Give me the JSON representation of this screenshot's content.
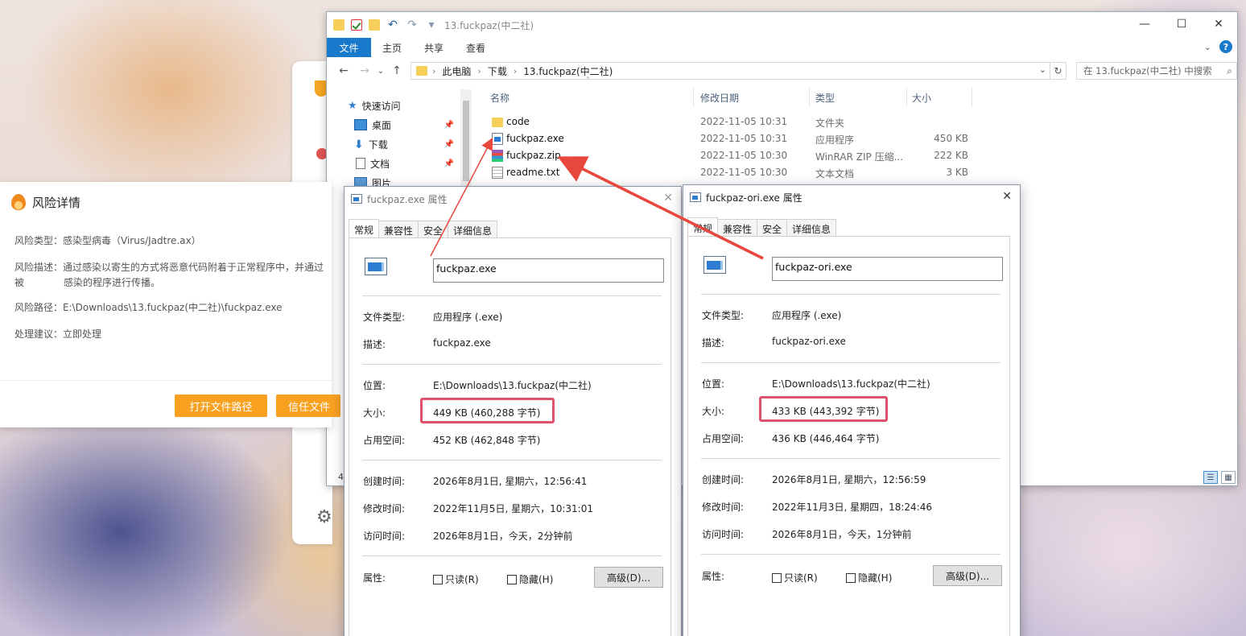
{
  "explorer": {
    "title": "13.fuckpaz(中二社)",
    "ribbon_tabs": [
      "文件",
      "主页",
      "共享",
      "查看"
    ],
    "breadcrumb": [
      "此电脑",
      "下载",
      "13.fuckpaz(中二社)"
    ],
    "search_placeholder": "在 13.fuckpaz(中二社) 中搜索",
    "nav_items": [
      {
        "label": "快速访问",
        "icon": "star-icon"
      },
      {
        "label": "桌面",
        "icon": "desktop-icon"
      },
      {
        "label": "下载",
        "icon": "download-icon"
      },
      {
        "label": "文档",
        "icon": "document-icon"
      },
      {
        "label": "图片",
        "icon": "picture-icon"
      }
    ],
    "columns": [
      "名称",
      "修改日期",
      "类型",
      "大小"
    ],
    "files": [
      {
        "name": "code",
        "date": "2022-11-05 10:31",
        "type": "文件夹",
        "size": "",
        "icon": "folder-icon"
      },
      {
        "name": "fuckpaz.exe",
        "date": "2022-11-05 10:31",
        "type": "应用程序",
        "size": "450 KB",
        "icon": "exe-icon"
      },
      {
        "name": "fuckpaz.zip",
        "date": "2022-11-05 10:30",
        "type": "WinRAR ZIP 压缩...",
        "size": "222 KB",
        "icon": "zip-icon"
      },
      {
        "name": "readme.txt",
        "date": "2022-11-05 10:30",
        "type": "文本文档",
        "size": "3 KB",
        "icon": "txt-icon"
      }
    ],
    "status_count": "4"
  },
  "risk": {
    "title": "风险详情",
    "type_label": "风险类型：",
    "type_value": "感染型病毒（Virus/Jadtre.ax）",
    "desc_label": "风险描述：",
    "desc_value_1": "通过感染以寄生的方式将恶意代码附着于正常程序中，并通过被",
    "desc_value_2": "感染的程序进行传播。",
    "path_label": "风险路径：",
    "path_value": "E:\\Downloads\\13.fuckpaz(中二社)\\fuckpaz.exe",
    "advice_label": "处理建议：",
    "advice_value": "立即处理",
    "open_button": "打开文件路径",
    "trust_button": "信任文件"
  },
  "dialog1": {
    "title": "fuckpaz.exe 属性",
    "tabs": [
      "常规",
      "兼容性",
      "安全",
      "详细信息"
    ],
    "filename": "fuckpaz.exe",
    "labels": {
      "type": "文件类型:",
      "desc": "描述:",
      "location": "位置:",
      "size": "大小:",
      "disk": "占用空间:",
      "created": "创建时间:",
      "modified": "修改时间:",
      "accessed": "访问时间:",
      "attrs": "属性:"
    },
    "type_value": "应用程序 (.exe)",
    "desc_value": "fuckpaz.exe",
    "location_value": "E:\\Downloads\\13.fuckpaz(中二社)",
    "size_value": "449 KB (460,288 字节)",
    "disk_value": "452 KB (462,848 字节)",
    "created_value": "2026年8月1日, 星期六，12:56:41",
    "modified_value": "2022年11月5日, 星期六，10:31:01",
    "accessed_value": "2026年8月1日，今天，2分钟前",
    "readonly_label": "只读(R)",
    "hidden_label": "隐藏(H)",
    "advanced_button": "高级(D)..."
  },
  "dialog2": {
    "title": "fuckpaz-ori.exe 属性",
    "tabs": [
      "常规",
      "兼容性",
      "安全",
      "详细信息"
    ],
    "filename": "fuckpaz-ori.exe",
    "labels": {
      "type": "文件类型:",
      "desc": "描述:",
      "location": "位置:",
      "size": "大小:",
      "disk": "占用空间:",
      "created": "创建时间:",
      "modified": "修改时间:",
      "accessed": "访问时间:",
      "attrs": "属性:"
    },
    "type_value": "应用程序 (.exe)",
    "desc_value": "fuckpaz-ori.exe",
    "location_value": "E:\\Downloads\\13.fuckpaz(中二社)",
    "size_value": "433 KB (443,392 字节)",
    "disk_value": "436 KB (446,464 字节)",
    "created_value": "2026年8月1日, 星期六，12:56:59",
    "modified_value": "2022年11月3日, 星期四，18:24:46",
    "accessed_value": "2026年8月1日，今天，1分钟前",
    "readonly_label": "只读(R)",
    "hidden_label": "隐藏(H)",
    "advanced_button": "高级(D)..."
  },
  "colors": {
    "accent": "#1979ca",
    "highlight": "#e0526c",
    "arrow": "#e8473e",
    "warn_button": "#f8a020"
  }
}
